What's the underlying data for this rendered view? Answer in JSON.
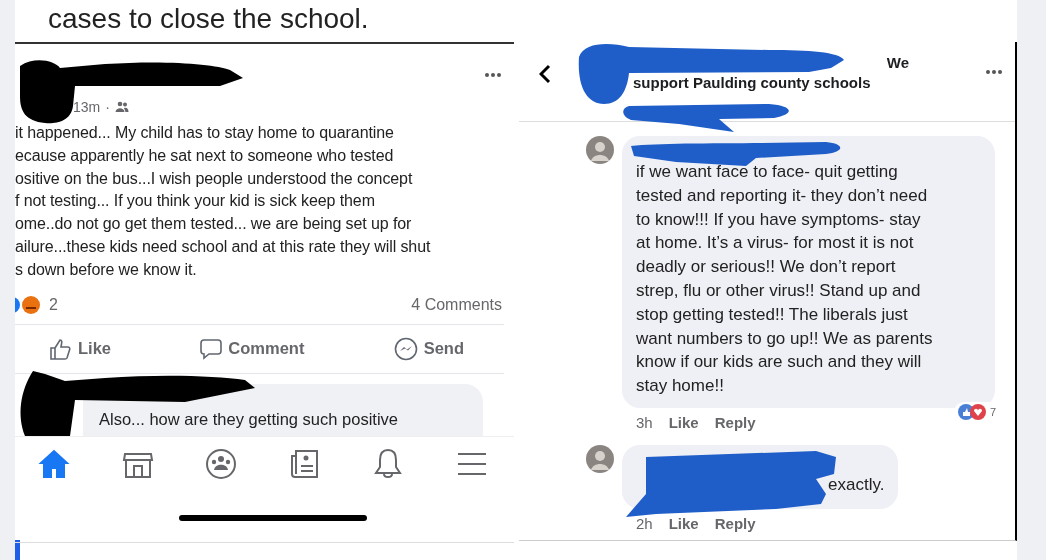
{
  "article": {
    "caption_fragment": "cases to close the school."
  },
  "left_screenshot": {
    "post": {
      "time": "13m",
      "separator": "·",
      "lines": [
        "it happened... My child has to stay home to quarantine",
        "ecause apparently he sat next to someone who tested",
        "ositive on the bus...I wish people understood the concept",
        "f not testing... If you think your kid is sick keep them",
        "ome..do not go get them tested... we are being set up for",
        "ailure...these kids need school and at this rate they will shut",
        "s down before we know it."
      ],
      "reaction_count": "2",
      "comments_count": "4 Comments",
      "actions": [
        {
          "kind": "like",
          "label": "Like"
        },
        {
          "kind": "comment",
          "label": "Comment"
        },
        {
          "kind": "send",
          "label": "Send"
        }
      ]
    },
    "comment_preview": "Also... how are they getting such positive",
    "nav": [
      {
        "kind": "home",
        "selected": true
      },
      {
        "kind": "marketplace",
        "selected": false
      },
      {
        "kind": "groups",
        "selected": false
      },
      {
        "kind": "news",
        "selected": false
      },
      {
        "kind": "bell",
        "selected": false
      },
      {
        "kind": "menu",
        "selected": false
      }
    ]
  },
  "right_screenshot": {
    "group_title_lines": [
      "We",
      "support Paulding county schools"
    ],
    "comments": [
      {
        "lines": [
          "if we want face to face- quit getting",
          "tested and reporting it- they don’t need",
          "to know!!! If you have symptoms- stay",
          "at home. It’s a virus- for most it is not",
          "deadly or serious!! We don’t report",
          "strep,  flu or other virus!! Stand up and",
          "stop getting tested!! The liberals just",
          "want numbers to go up!!  We as parents",
          "know if our kids are such and they will",
          "stay home!!"
        ],
        "time": "3h",
        "like": "Like",
        "reply": "Reply",
        "reaction_count": "7"
      },
      {
        "lines": [
          "exactly."
        ],
        "time": "2h",
        "like": "Like",
        "reply": "Reply"
      }
    ]
  }
}
